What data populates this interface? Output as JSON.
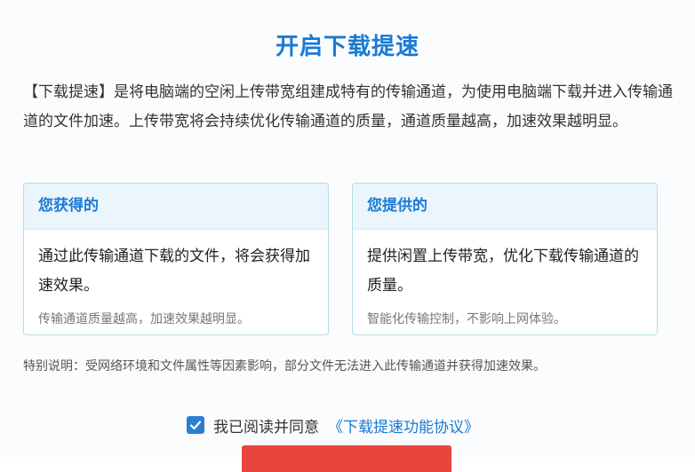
{
  "dialog": {
    "title": "开启下载提速",
    "intro": "【下载提速】是将电脑端的空闲上传带宽组建成特有的传输通道，为使用电脑端下载并进入传输通道的文件加速。上传带宽将会持续优化传输通道的质量，通道质量越高，加速效果越明显。",
    "gain_card": {
      "heading": "您获得的",
      "main": "通过此传输通道下载的文件，将会获得加速效果。",
      "sub": "传输通道质量越高，加速效果越明显。"
    },
    "provide_card": {
      "heading": "您提供的",
      "main": "提供闲置上传带宽，优化下载传输通道的质量。",
      "sub": "智能化传输控制，不影响上网体验。"
    },
    "note": "特别说明：受网络环境和文件属性等因素影响，部分文件无法进入此传输通道并获得加速效果。",
    "agreement": {
      "checked": true,
      "label": "我已阅读并同意",
      "link": "《下载提速功能协议》"
    }
  },
  "colors": {
    "accent_blue": "#1a7ad4",
    "card_border": "#b6dbe6",
    "card_header_bg": "#eaf6fb",
    "primary_button": "#e8453c"
  },
  "icons": {
    "checkbox": "check-icon"
  }
}
